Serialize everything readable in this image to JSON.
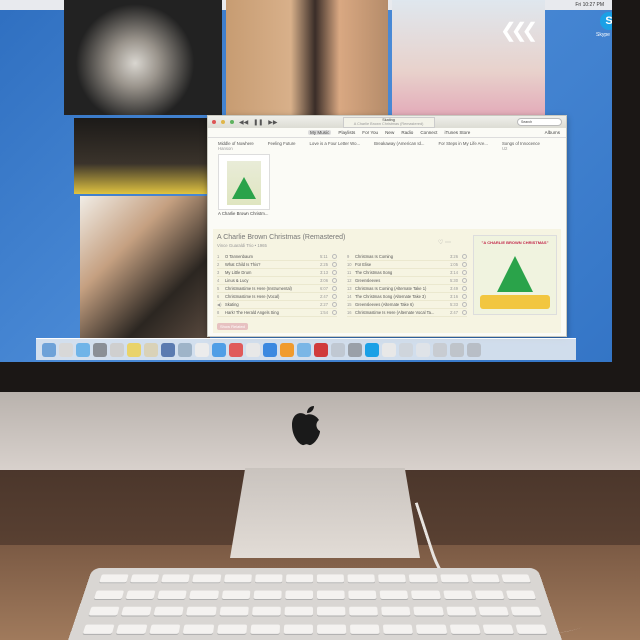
{
  "menubar": {
    "clock": "Fri 10:27 PM"
  },
  "desktop": {
    "skype_label": "Skype"
  },
  "itunes": {
    "now_playing": "Skating",
    "now_playing_album": "A Charlie Brown Christmas (Remastered)",
    "nav": [
      "My Music",
      "Playlists",
      "For You",
      "New",
      "Radio",
      "Connect",
      "iTunes Store"
    ],
    "albums_label": "Albums",
    "search_placeholder": "Search",
    "strip": [
      {
        "title": "Middle of Nowhere",
        "sub": "Hanson"
      },
      {
        "title": "Feeling Future",
        "sub": ""
      },
      {
        "title": "Love is a Four Letter Wo...",
        "sub": ""
      },
      {
        "title": "Breakaway (American Id...",
        "sub": ""
      },
      {
        "title": "For Steps in My Life Are...",
        "sub": ""
      },
      {
        "title": "Songs of Innocence",
        "sub": "U2"
      }
    ],
    "selected_thumb_caption": "A Charlie Brown Christm...",
    "album_title": "A Charlie Brown Christmas (Remastered)",
    "album_sub": "Vince Guaraldi Trio • 1965",
    "cover_banner": "\"A CHARLIE BROWN CHRISTMAS\"",
    "show_related": "Show Related",
    "tracks_left": [
      {
        "n": "1",
        "t": "O Tannenbaum",
        "d": "5:11"
      },
      {
        "n": "2",
        "t": "What Child Is This?",
        "d": "2:25"
      },
      {
        "n": "3",
        "t": "My Little Drum",
        "d": "3:13"
      },
      {
        "n": "4",
        "t": "Linus & Lucy",
        "d": "3:06"
      },
      {
        "n": "5",
        "t": "Christmastime Is Here (Instrumental)",
        "d": "6:07"
      },
      {
        "n": "6",
        "t": "Christmastime Is Here (Vocal)",
        "d": "2:47"
      },
      {
        "n": "◀)",
        "t": "Skating",
        "d": "2:27"
      },
      {
        "n": "8",
        "t": "Hark! The Herald Angels Sing",
        "d": "1:54"
      }
    ],
    "tracks_right": [
      {
        "n": "9",
        "t": "Christmas Is Coming",
        "d": "3:26"
      },
      {
        "n": "10",
        "t": "Für Elise",
        "d": "1:05"
      },
      {
        "n": "11",
        "t": "The Christmas Song",
        "d": "3:14"
      },
      {
        "n": "12",
        "t": "Greensleeves",
        "d": "5:30"
      },
      {
        "n": "13",
        "t": "Christmas Is Coming (Alternate Take 1)",
        "d": "3:49"
      },
      {
        "n": "14",
        "t": "The Christmas Song (Alternate Take 3)",
        "d": "3:16"
      },
      {
        "n": "15",
        "t": "Greensleeves (Alternate Take 6)",
        "d": "5:33"
      },
      {
        "n": "16",
        "t": "Christmastime Is Here (Alternate Vocal Ta...",
        "d": "2:47"
      }
    ]
  },
  "colors": {
    "desktop_blue": "#3a7bcc",
    "accent_skype": "#1aa0e6",
    "tree_green": "#2aa34a"
  }
}
